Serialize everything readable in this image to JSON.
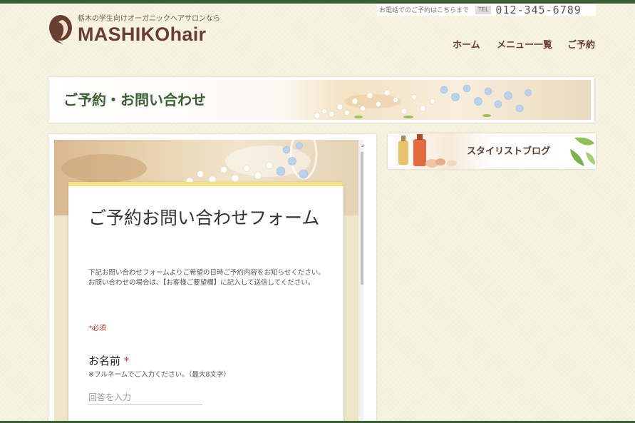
{
  "header": {
    "tagline": "栃木の学生向けオーガニックヘアサロンなら",
    "site_name": "MASHIKOhair",
    "phone_note": "お電話でのご予約はこちらまで",
    "tel_label": "TEL",
    "phone_number": "012-345-6789"
  },
  "nav": {
    "items": [
      {
        "label": "ホーム"
      },
      {
        "label": "メニュー一覧"
      },
      {
        "label": "ご予約"
      }
    ]
  },
  "page_title": "ご予約・お問い合わせ",
  "form": {
    "title": "ご予約お問い合わせフォーム",
    "description_line1": "下記お問い合わせフォームよりご希望の日時ご予約内容をお知らせください。",
    "description_line2": "お問い合わせの場合は、【お客様ご要望欄】に記入して送信してください。",
    "required_note": "*必須",
    "question_label": "お名前",
    "required_star": "*",
    "question_help": "※フルネームでご入力ください。（最大8文字）",
    "answer_placeholder": "回答を入力"
  },
  "sidebar": {
    "blog_label": "スタイリストブログ"
  },
  "colors": {
    "accent_green": "#3b5e35",
    "brand_brown": "#6a3d32",
    "required_red": "#c53929",
    "form_accent": "#f5df85",
    "page_background": "#f8f4e3"
  },
  "icons": {
    "logo": "hair-silhouette-icon",
    "scroll_up": "scroll-up-arrow-icon"
  }
}
